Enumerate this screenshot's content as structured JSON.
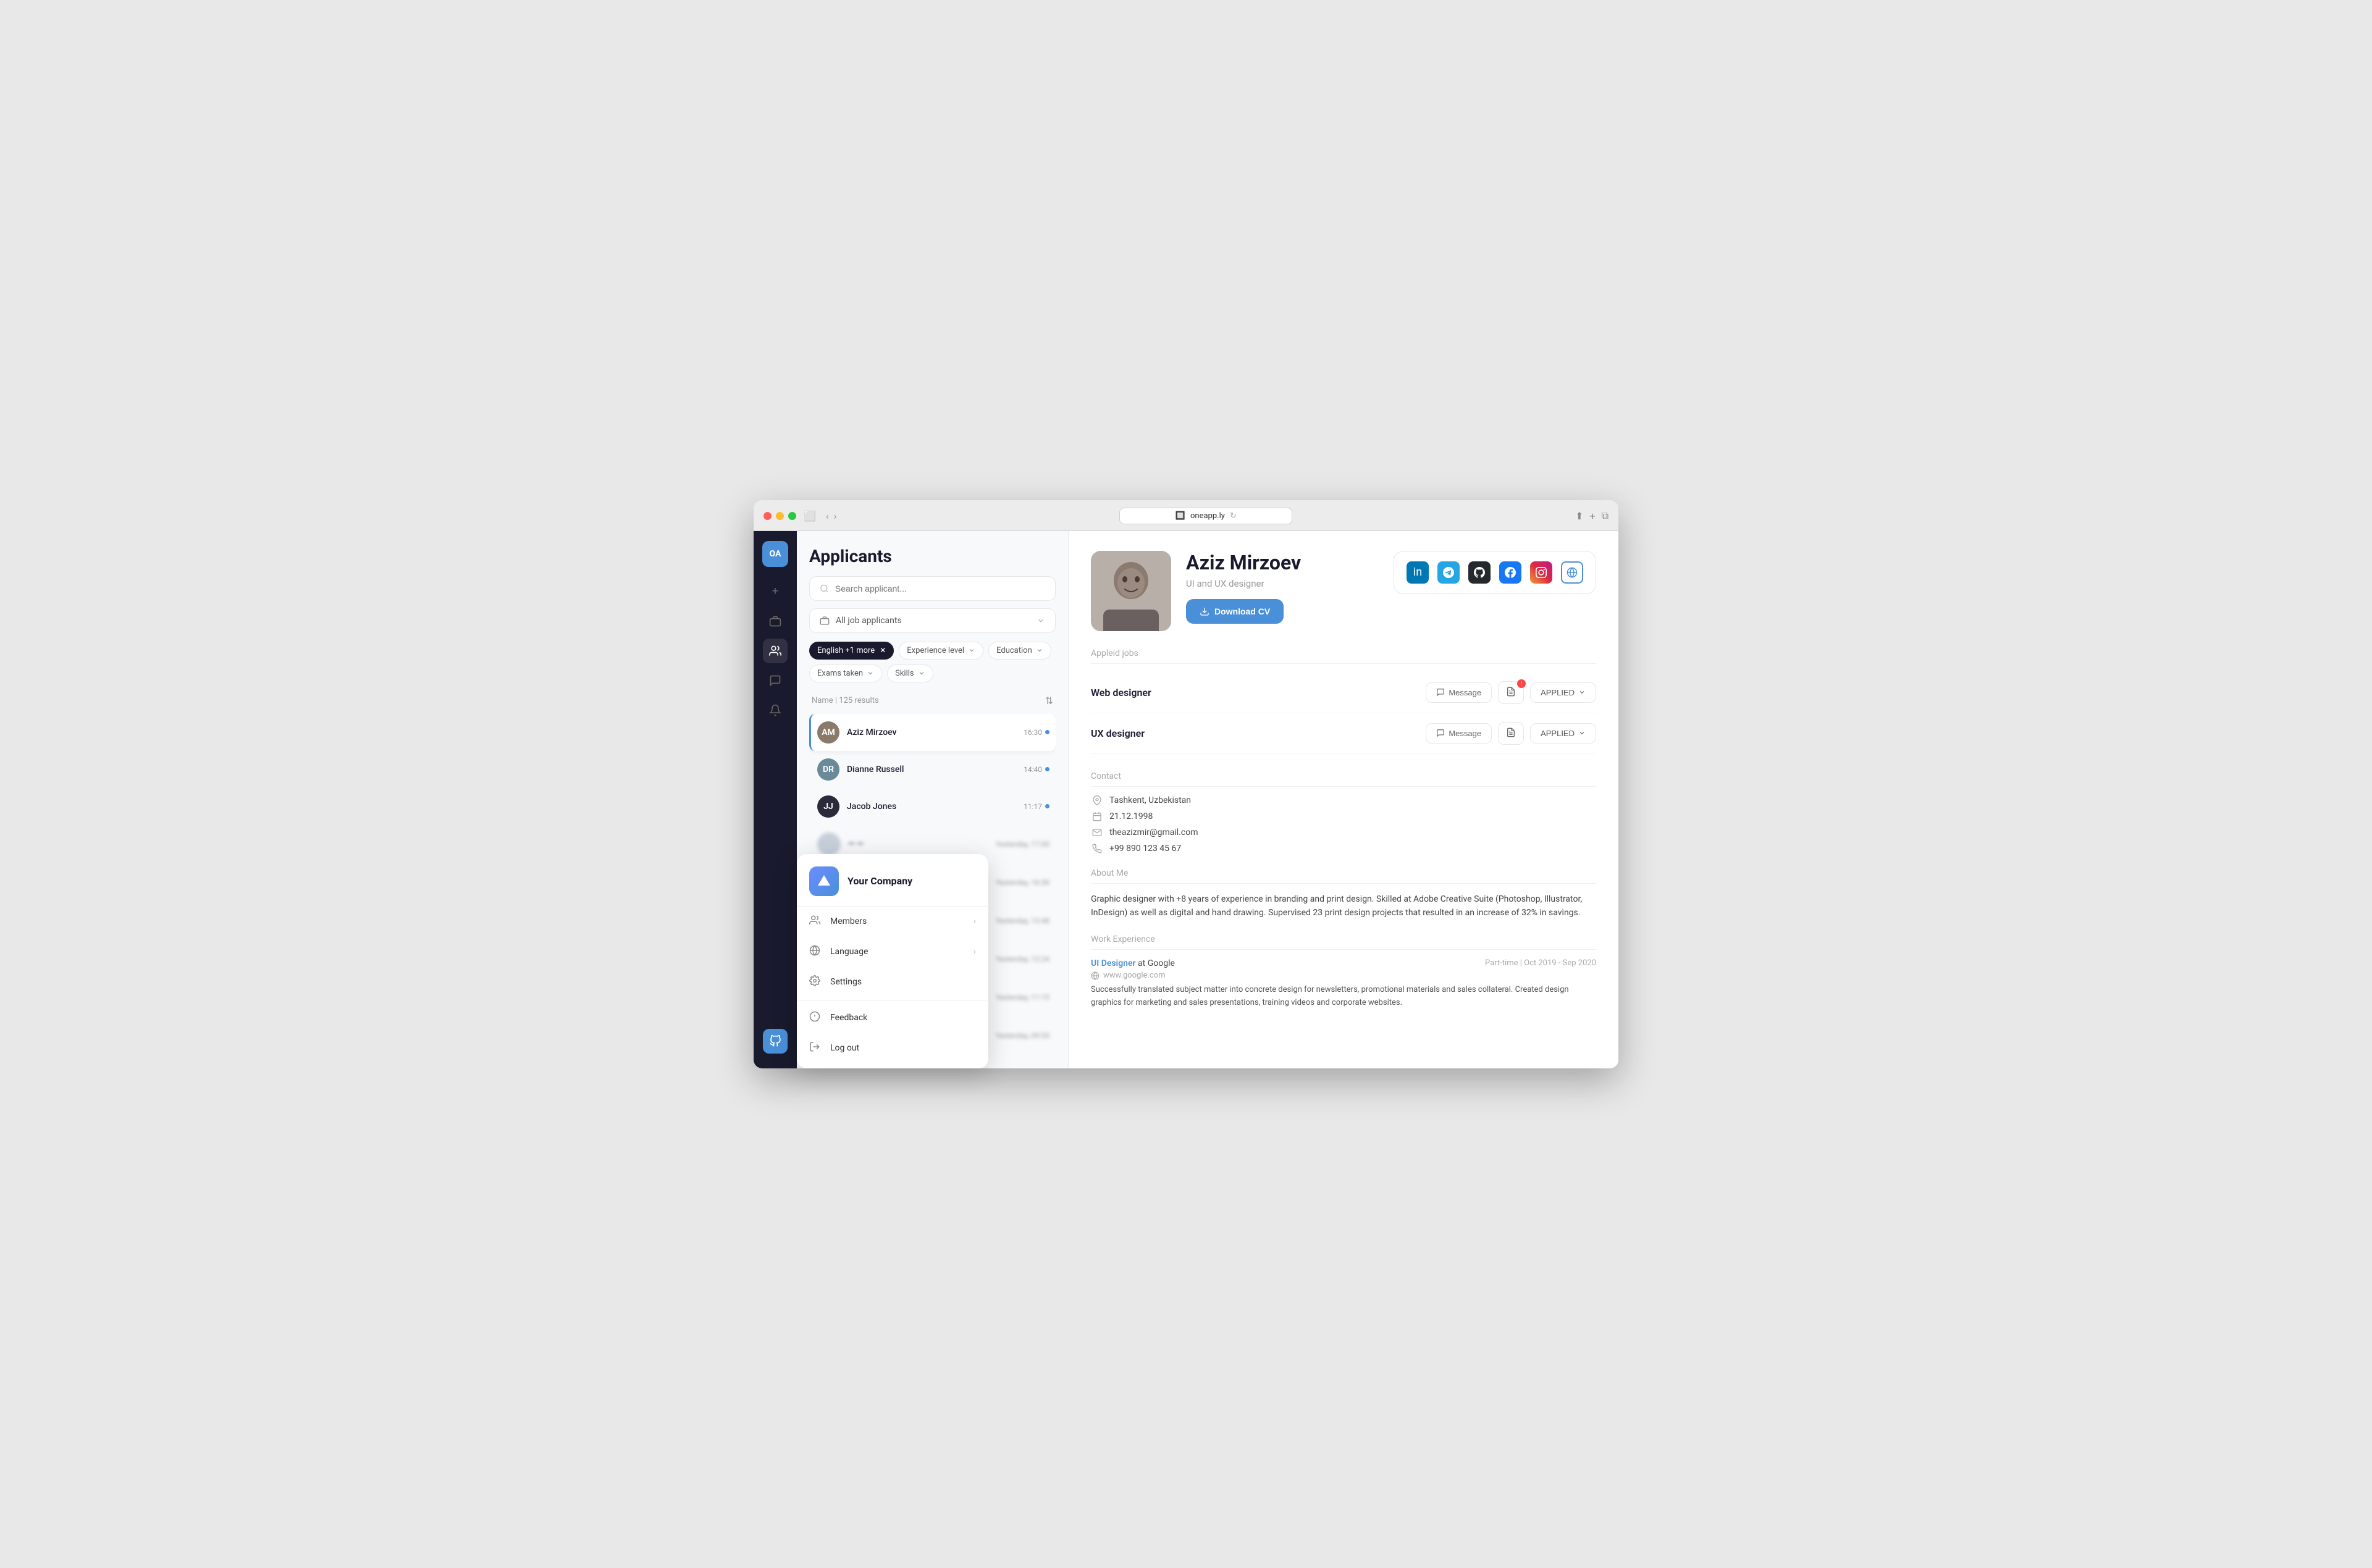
{
  "browser": {
    "url": "oneapp.ly",
    "tab_label": "oneapp.ly"
  },
  "sidebar": {
    "logo_text": "OA",
    "icons": [
      {
        "name": "plus-icon",
        "symbol": "+"
      },
      {
        "name": "briefcase-icon",
        "symbol": "💼"
      },
      {
        "name": "users-icon",
        "symbol": "👥"
      },
      {
        "name": "chat-icon",
        "symbol": "💬"
      },
      {
        "name": "bell-icon",
        "symbol": "🔔"
      }
    ]
  },
  "applicants_panel": {
    "title": "Applicants",
    "search_placeholder": "Search applicant...",
    "job_filter": "All job applicants",
    "filters": [
      {
        "label": "English +1 more",
        "active": true,
        "removable": true
      },
      {
        "label": "Experience level",
        "active": false,
        "removable": false
      },
      {
        "label": "Education",
        "active": false,
        "removable": false
      },
      {
        "label": "Exams taken",
        "active": false,
        "removable": false
      },
      {
        "label": "Skills",
        "active": false,
        "removable": false
      }
    ],
    "results_count": "Name | 125 results",
    "applicants": [
      {
        "name": "Aziz Mirzoev",
        "time": "16:30",
        "active": true,
        "initials": "AM",
        "color": "#8a7a6a"
      },
      {
        "name": "Dianne Russell",
        "time": "14:40",
        "active": false,
        "initials": "DR",
        "color": "#6a8a9a"
      },
      {
        "name": "Jacob Jones",
        "time": "11:17",
        "active": false,
        "initials": "JJ",
        "color": "#2a2a3a"
      },
      {
        "name": "",
        "time": "Yesterday, 17:00",
        "active": false,
        "initials": "",
        "color": "#c8d0dc"
      },
      {
        "name": "",
        "time": "Yesterday, 16:30",
        "active": false,
        "initials": "",
        "color": "#c8d0dc"
      },
      {
        "name": "",
        "time": "Yesterday, 13:48",
        "active": false,
        "initials": "",
        "color": "#c8d0dc"
      },
      {
        "name": "",
        "time": "Yesterday, 12:24",
        "active": false,
        "initials": "",
        "color": "#c8d0dc"
      },
      {
        "name": "",
        "time": "Yesterday, 11:15",
        "active": false,
        "initials": "",
        "color": "#c8d0dc"
      },
      {
        "name": "",
        "time": "Yesterday, 09:55",
        "active": false,
        "initials": "",
        "color": "#c8d0dc"
      }
    ]
  },
  "profile": {
    "name": "Aziz Mirzoev",
    "role": "UI and UX designer",
    "download_cv_label": "Download CV",
    "social_links": [
      "linkedin",
      "telegram",
      "github",
      "facebook",
      "instagram",
      "globe"
    ],
    "applied_jobs_label": "Appleid jobs",
    "jobs": [
      {
        "title": "Web designer",
        "message_label": "Message",
        "status_label": "APPLIED"
      },
      {
        "title": "UX designer",
        "message_label": "Message",
        "status_label": "APPLIED"
      }
    ],
    "contact_label": "Contact",
    "contact": {
      "location": "Tashkent, Uzbekistan",
      "dob": "21.12.1998",
      "email": "theazizmir@gmail.com",
      "phone": "+99 890 123 45 67"
    },
    "about_label": "About Me",
    "about_text": "Graphic designer with +8 years of experience in branding and print design. Skilled at Adobe Creative Suite (Photoshop, Illustrator, InDesign) as well as digital and hand drawing. Supervised 23 print design projects that resulted in an increase of 32% in savings.",
    "work_label": "Work Experience",
    "work_items": [
      {
        "title": "UI Designer",
        "company": "at Google",
        "period": "Part-time | Oct 2019 - Sep 2020",
        "url": "www.google.com",
        "description": "Successfully translated subject matter into concrete design for newsletters, promotional materials and sales collateral. Created design graphics for marketing and sales presentations, training videos and corporate websites."
      }
    ]
  },
  "company_popup": {
    "logo_symbol": "▲",
    "name": "Your Company",
    "menu_items": [
      {
        "label": "Members",
        "icon": "👤",
        "has_chevron": true
      },
      {
        "label": "Language",
        "icon": "🌐",
        "has_chevron": true
      },
      {
        "label": "Settings",
        "icon": "⚙️",
        "has_chevron": false
      },
      {
        "label": "Feedback",
        "icon": "?",
        "has_chevron": false
      },
      {
        "label": "Log out",
        "icon": "→",
        "has_chevron": false
      }
    ]
  }
}
